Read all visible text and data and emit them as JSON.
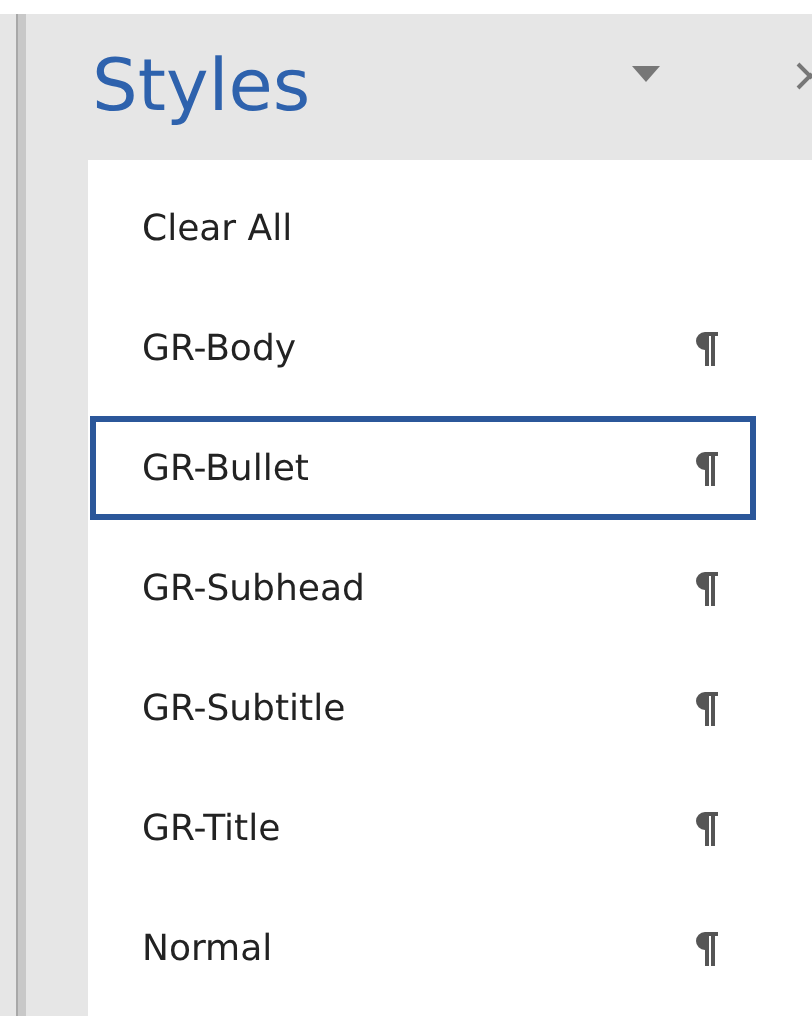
{
  "pane": {
    "title": "Styles"
  },
  "styles": [
    {
      "label": "Clear All",
      "kind": "action",
      "selected": false
    },
    {
      "label": "GR-Body",
      "kind": "paragraph",
      "selected": false
    },
    {
      "label": "GR-Bullet",
      "kind": "paragraph",
      "selected": true
    },
    {
      "label": "GR-Subhead",
      "kind": "paragraph",
      "selected": false
    },
    {
      "label": "GR-Subtitle",
      "kind": "paragraph",
      "selected": false
    },
    {
      "label": "GR-Title",
      "kind": "paragraph",
      "selected": false
    },
    {
      "label": "Normal",
      "kind": "paragraph",
      "selected": false
    }
  ]
}
